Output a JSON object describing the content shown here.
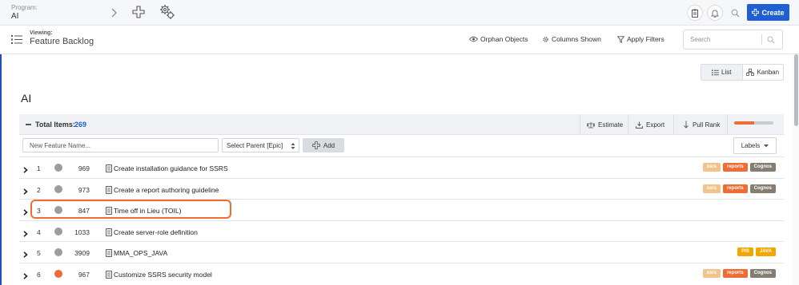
{
  "topbar": {
    "program_label": "Program:",
    "program_value": "AI",
    "create_label": "Create"
  },
  "viewbar": {
    "viewing_label": "Viewing:",
    "viewing_value": "Feature Backlog",
    "orphan_label": "Orphan Objects",
    "columns_label": "Columns Shown",
    "filters_label": "Apply Filters",
    "search_placeholder": "Search"
  },
  "toggle": {
    "list_label": "List",
    "kanban_label": "Kanban",
    "active": "List"
  },
  "page_title": "AI",
  "panel": {
    "total_label": "Total Items:",
    "total_count": "269",
    "estimate_label": "Estimate",
    "export_label": "Export",
    "pull_rank_label": "Pull Rank",
    "progress_fraction": 0.5
  },
  "add_row": {
    "new_feature_placeholder": "New Feature Name...",
    "select_parent_label": "Select Parent [Epic]",
    "add_label": "Add",
    "labels_dropdown": "Labels"
  },
  "colors": {
    "accent": "#1f5fd1",
    "highlight": "#ef6c34",
    "status_gray": "#9a9da2",
    "status_orange": "#ef6c34",
    "tag_ssrs": "#f0c48a",
    "tag_reports": "#ef6c34",
    "tag_cognos": "#857d72",
    "tag_pis": "#f0a800",
    "tag_java": "#f0a800"
  },
  "rows": [
    {
      "num": "1",
      "id": "969",
      "name": "Create installation guidance for SSRS",
      "status": "gray",
      "labels": [
        "ssrs",
        "reports",
        "Cognos"
      ]
    },
    {
      "num": "2",
      "id": "973",
      "name": "Create a report authoring guideline",
      "status": "gray",
      "labels": [
        "ssrs",
        "reports",
        "Cognos"
      ]
    },
    {
      "num": "3",
      "id": "847",
      "name": "Time off in Lieu (TOIL)",
      "status": "gray",
      "labels": []
    },
    {
      "num": "4",
      "id": "1033",
      "name": "Create server-role definition",
      "status": "gray",
      "labels": []
    },
    {
      "num": "5",
      "id": "3909",
      "name": "MMA_OPS_JAVA",
      "status": "gray",
      "labels": [
        "PIS",
        "JAVA"
      ]
    },
    {
      "num": "6",
      "id": "967",
      "name": "Customize SSRS security model",
      "status": "orange",
      "labels": [
        "ssrs",
        "reports",
        "Cognos"
      ]
    }
  ]
}
